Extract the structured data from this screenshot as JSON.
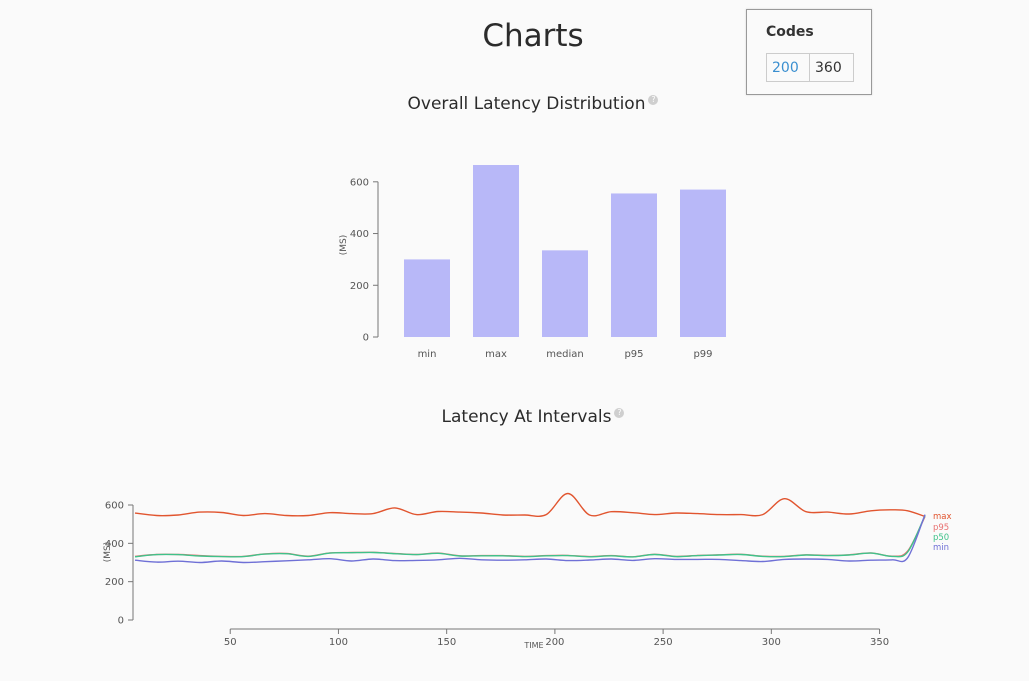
{
  "page": {
    "title": "Charts"
  },
  "codes": {
    "title": "Codes",
    "entries": [
      {
        "code": "200",
        "count": "360"
      }
    ]
  },
  "sections": {
    "distribution": {
      "title": "Overall Latency Distribution",
      "help_icon": "question-circle-icon"
    },
    "intervals": {
      "title": "Latency At Intervals",
      "help_icon": "question-circle-icon"
    }
  },
  "colors": {
    "bar": "#b8b8f8",
    "max": "#e1552f",
    "p95": "#e87070",
    "p50": "#3fc28a",
    "min": "#6f70d6"
  },
  "chart_data": [
    {
      "type": "bar",
      "title": "Overall Latency Distribution",
      "categories": [
        "min",
        "max",
        "median",
        "p95",
        "p99"
      ],
      "values": [
        300,
        665,
        335,
        555,
        570
      ],
      "ylabel": "(MS)",
      "xlabel": "",
      "ylim": [
        0,
        665
      ],
      "yticks": [
        0,
        200,
        400,
        600
      ],
      "grid": false
    },
    {
      "type": "line",
      "title": "Latency At Intervals",
      "xlabel": "TIME",
      "ylabel": "(MS)",
      "xlim": [
        6,
        371
      ],
      "ylim": [
        0,
        600
      ],
      "xticks": [
        50,
        100,
        150,
        200,
        250,
        300,
        350
      ],
      "yticks": [
        0,
        200,
        400,
        600
      ],
      "legend_position": "right",
      "x": [
        6,
        16,
        26,
        36,
        46,
        56,
        66,
        76,
        86,
        96,
        106,
        116,
        126,
        136,
        146,
        156,
        166,
        176,
        186,
        196,
        206,
        216,
        226,
        236,
        246,
        256,
        266,
        276,
        286,
        296,
        306,
        316,
        326,
        336,
        346,
        356,
        363,
        371
      ],
      "series": [
        {
          "name": "max",
          "values": [
            558,
            545,
            548,
            563,
            561,
            545,
            555,
            545,
            545,
            560,
            555,
            555,
            585,
            550,
            566,
            563,
            558,
            548,
            548,
            550,
            660,
            548,
            565,
            560,
            550,
            558,
            555,
            550,
            550,
            550,
            633,
            565,
            563,
            553,
            570,
            575,
            570,
            540
          ]
        },
        {
          "name": "p95",
          "values": [
            332,
            342,
            342,
            336,
            332,
            332,
            345,
            347,
            333,
            350,
            352,
            353,
            347,
            342,
            349,
            335,
            336,
            336,
            332,
            336,
            337,
            331,
            336,
            330,
            343,
            332,
            337,
            340,
            343,
            333,
            332,
            340,
            337,
            340,
            350,
            333,
            360,
            540
          ]
        },
        {
          "name": "p50",
          "values": [
            330,
            341,
            341,
            334,
            331,
            331,
            344,
            346,
            332,
            349,
            351,
            352,
            346,
            341,
            348,
            334,
            335,
            335,
            331,
            335,
            336,
            330,
            335,
            329,
            342,
            331,
            336,
            339,
            342,
            332,
            331,
            339,
            336,
            339,
            349,
            332,
            355,
            545
          ]
        },
        {
          "name": "min",
          "values": [
            312,
            302,
            307,
            300,
            308,
            300,
            304,
            309,
            314,
            320,
            308,
            318,
            310,
            311,
            314,
            322,
            314,
            312,
            314,
            318,
            310,
            313,
            318,
            311,
            320,
            316,
            316,
            316,
            310,
            305,
            316,
            318,
            316,
            308,
            312,
            314,
            325,
            550
          ]
        }
      ]
    }
  ]
}
